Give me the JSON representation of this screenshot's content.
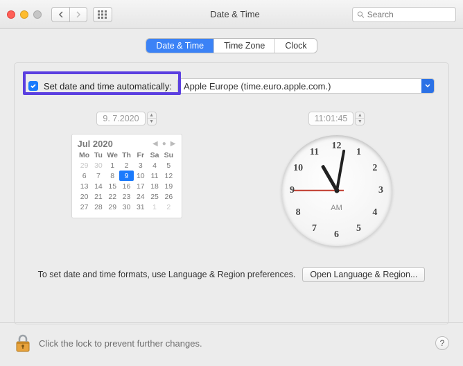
{
  "window": {
    "title": "Date & Time",
    "search_placeholder": "Search"
  },
  "tabs": {
    "t0": "Date & Time",
    "t1": "Time Zone",
    "t2": "Clock"
  },
  "auto": {
    "checked": true,
    "label": "Set date and time automatically:",
    "server": "Apple Europe (time.euro.apple.com.)"
  },
  "date_field": "9.  7.2020",
  "time_field": "11:01:45",
  "calendar": {
    "title": "Jul 2020",
    "dow": [
      "Mo",
      "Tu",
      "We",
      "Th",
      "Fr",
      "Sa",
      "Su"
    ],
    "days": [
      {
        "n": "29",
        "o": true
      },
      {
        "n": "30",
        "o": true
      },
      {
        "n": "1"
      },
      {
        "n": "2"
      },
      {
        "n": "3"
      },
      {
        "n": "4"
      },
      {
        "n": "5"
      },
      {
        "n": "6"
      },
      {
        "n": "7"
      },
      {
        "n": "8"
      },
      {
        "n": "9",
        "sel": true
      },
      {
        "n": "10"
      },
      {
        "n": "11"
      },
      {
        "n": "12"
      },
      {
        "n": "13"
      },
      {
        "n": "14"
      },
      {
        "n": "15"
      },
      {
        "n": "16"
      },
      {
        "n": "17"
      },
      {
        "n": "18"
      },
      {
        "n": "19"
      },
      {
        "n": "20"
      },
      {
        "n": "21"
      },
      {
        "n": "22"
      },
      {
        "n": "23"
      },
      {
        "n": "24"
      },
      {
        "n": "25"
      },
      {
        "n": "26"
      },
      {
        "n": "27"
      },
      {
        "n": "28"
      },
      {
        "n": "29"
      },
      {
        "n": "30"
      },
      {
        "n": "31"
      },
      {
        "n": "1",
        "o": true
      },
      {
        "n": "2",
        "o": true
      }
    ]
  },
  "clock": {
    "ampm": "AM",
    "numbers": [
      "12",
      "1",
      "2",
      "3",
      "4",
      "5",
      "6",
      "7",
      "8",
      "9",
      "10",
      "11"
    ]
  },
  "footer": {
    "text": "To set date and time formats, use Language & Region preferences.",
    "button": "Open Language & Region..."
  },
  "lock": {
    "text": "Click the lock to prevent further changes.",
    "help": "?"
  }
}
